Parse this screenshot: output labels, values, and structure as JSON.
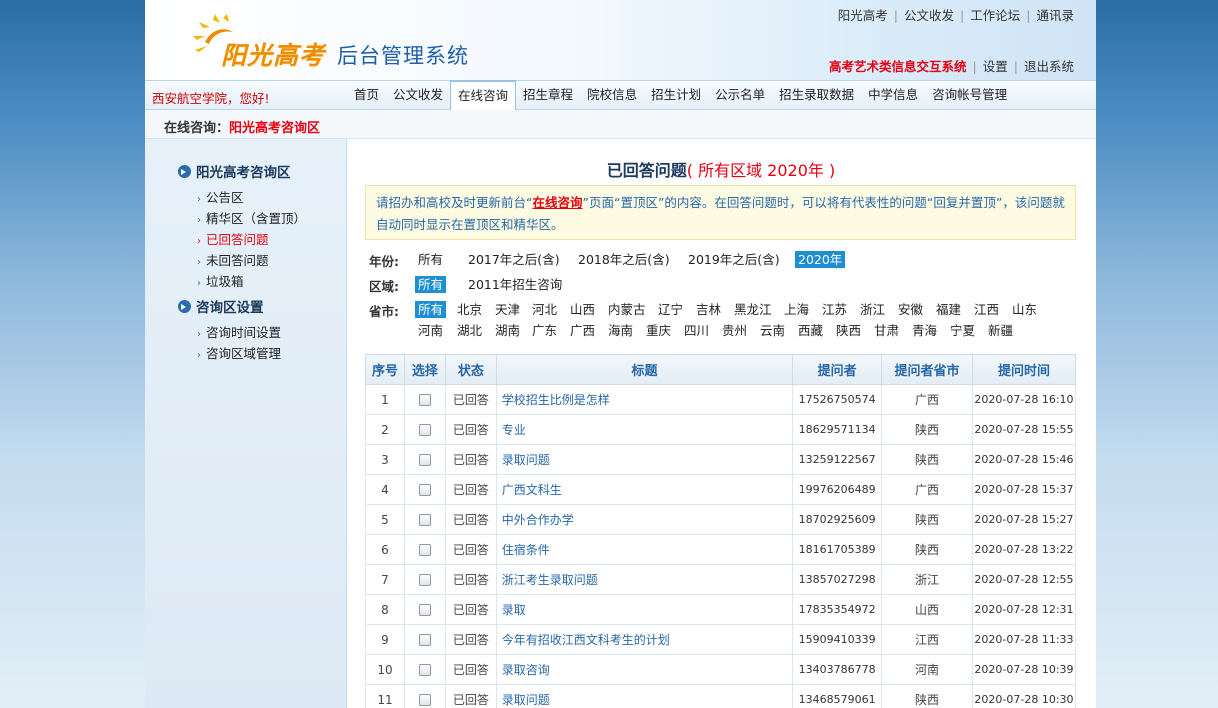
{
  "header": {
    "logo_text": "阳光高考",
    "system_title": "后台管理系统",
    "top_links": [
      "阳光高考",
      "公文收发",
      "工作论坛",
      "通讯录"
    ],
    "art_system": "高考艺术类信息交互系统",
    "settings": "设置",
    "logout": "退出系统"
  },
  "nav": {
    "greeting": "西安航空学院，您好!",
    "items": [
      "首页",
      "公文收发",
      "在线咨询",
      "招生章程",
      "院校信息",
      "招生计划",
      "公示名单",
      "招生录取数据",
      "中学信息",
      "咨询帐号管理"
    ],
    "active": "在线咨询"
  },
  "breadcrumb": {
    "prefix": "在线咨询：",
    "current": "阳光高考咨询区"
  },
  "sidebar": {
    "group1": "阳光高考咨询区",
    "group1_items": [
      "公告区",
      "精华区（含置顶）",
      "已回答问题",
      "未回答问题",
      "垃圾箱"
    ],
    "group2": "咨询区设置",
    "group2_items": [
      "咨询时间设置",
      "咨询区域管理"
    ]
  },
  "main": {
    "title": "已回答问题",
    "title_sub": "( 所有区域  2020年 )",
    "notice_1": "请招办和高校及时更新前台“",
    "notice_link": "在线咨询",
    "notice_2": "”页面“置顶区”的内容。在回答问题时，可以将有代表性的问题“回复并置顶”，该问题就自动同时显示在置顶区和精华区。",
    "year_label": "年份:",
    "years": [
      "所有",
      "2017年之后(含)",
      "2018年之后(含)",
      "2019年之后(含)",
      "2020年"
    ],
    "region_label": "区域:",
    "regions": [
      "所有",
      "2011年招生咨询"
    ],
    "province_label": "省市:",
    "provinces_row1": [
      "所有",
      "北京",
      "天津",
      "河北",
      "山西",
      "内蒙古",
      "辽宁",
      "吉林",
      "黑龙江",
      "上海",
      "江苏",
      "浙江",
      "安徽",
      "福建",
      "江西",
      "山东"
    ],
    "provinces_row2": [
      "河南",
      "湖北",
      "湖南",
      "广东",
      "广西",
      "海南",
      "重庆",
      "四川",
      "贵州",
      "云南",
      "西藏",
      "陕西",
      "甘肃",
      "青海",
      "宁夏",
      "新疆"
    ]
  },
  "table": {
    "headers": [
      "序号",
      "选择",
      "状态",
      "标题",
      "提问者",
      "提问者省市",
      "提问时间"
    ],
    "rows": [
      {
        "no": "1",
        "status": "已回答",
        "title": "学校招生比例是怎样",
        "asker": "17526750574",
        "province": "广西",
        "time": "2020-07-28 16:10"
      },
      {
        "no": "2",
        "status": "已回答",
        "title": "专业",
        "asker": "18629571134",
        "province": "陕西",
        "time": "2020-07-28 15:55"
      },
      {
        "no": "3",
        "status": "已回答",
        "title": "录取问题",
        "asker": "13259122567",
        "province": "陕西",
        "time": "2020-07-28 15:46"
      },
      {
        "no": "4",
        "status": "已回答",
        "title": "广西文科生",
        "asker": "19976206489",
        "province": "广西",
        "time": "2020-07-28 15:37"
      },
      {
        "no": "5",
        "status": "已回答",
        "title": "中外合作办学",
        "asker": "18702925609",
        "province": "陕西",
        "time": "2020-07-28 15:27"
      },
      {
        "no": "6",
        "status": "已回答",
        "title": "住宿条件",
        "asker": "18161705389",
        "province": "陕西",
        "time": "2020-07-28 13:22"
      },
      {
        "no": "7",
        "status": "已回答",
        "title": "浙江考生录取问题",
        "asker": "13857027298",
        "province": "浙江",
        "time": "2020-07-28 12:55"
      },
      {
        "no": "8",
        "status": "已回答",
        "title": "录取",
        "asker": "17835354972",
        "province": "山西",
        "time": "2020-07-28 12:31"
      },
      {
        "no": "9",
        "status": "已回答",
        "title": "今年有招收江西文科考生的计划",
        "asker": "15909410339",
        "province": "江西",
        "time": "2020-07-28 11:33"
      },
      {
        "no": "10",
        "status": "已回答",
        "title": "录取咨询",
        "asker": "13403786778",
        "province": "河南",
        "time": "2020-07-28 10:39"
      },
      {
        "no": "11",
        "status": "已回答",
        "title": "录取问题",
        "asker": "13468579061",
        "province": "陕西",
        "time": "2020-07-28 10:30"
      }
    ]
  }
}
